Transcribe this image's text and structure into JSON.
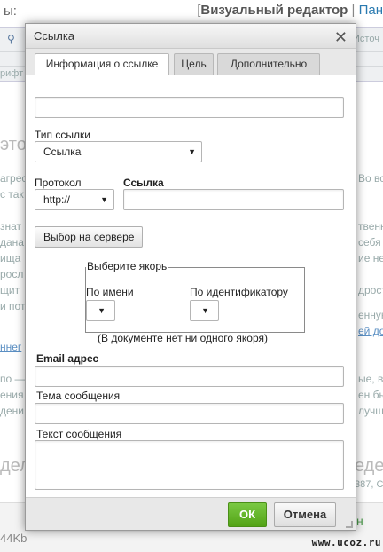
{
  "background": {
    "top_left_fragment": "ы:",
    "title_editor": "Визуальный редактор",
    "title_separator": " | ",
    "title_link": "Пан",
    "toolbar_fragment_right": "Источ",
    "toolbar_fragment_left": "рифт",
    "heading_left": "это",
    "heading_bottom_left": "дел",
    "heading_bottom_right": "еден",
    "frag_left": [
      "агрес",
      "с так",
      "знат",
      "дана",
      "ища",
      "росл",
      "щит",
      "и пот",
      "ннег",
      "по —",
      "ения",
      "дени"
    ],
    "frag_right": [
      "Во все",
      "",
      "твенно",
      "себя",
      "ие не",
      "",
      "дрост",
      "енную",
      "ей до",
      "ые, в",
      "ен бы",
      "лучше"
    ],
    "bottom_right_fragment": "387, С",
    "bottom_size": "44Kb",
    "bottom_letter": "н",
    "watermark": "www.ucoz.ru"
  },
  "dialog": {
    "title": "Ссылка",
    "close_glyph": "✕",
    "tabs": [
      {
        "label": "Информация о ссылке",
        "active": true
      },
      {
        "label": "Цель",
        "active": false
      },
      {
        "label": "Дополнительно",
        "active": false
      }
    ],
    "display_text_value": "",
    "link_type": {
      "label": "Тип ссылки",
      "value": "Ссылка"
    },
    "protocol": {
      "label": "Протокол",
      "value": "http://"
    },
    "url": {
      "label": "Ссылка",
      "value": ""
    },
    "browse_server_label": "Выбор на сервере",
    "anchor": {
      "legend": "Выберите якорь",
      "by_name_label": "По имени",
      "by_id_label": "По идентификатору",
      "no_anchors_note": "(В документе нет ни одного якоря)"
    },
    "email": {
      "label": "Email адрес",
      "value": ""
    },
    "subject": {
      "label": "Тема сообщения",
      "value": ""
    },
    "body": {
      "label": "Текст сообщения",
      "value": ""
    },
    "ok_label": "ОК",
    "cancel_label": "Отмена",
    "ok_color": "#5cb01f"
  }
}
